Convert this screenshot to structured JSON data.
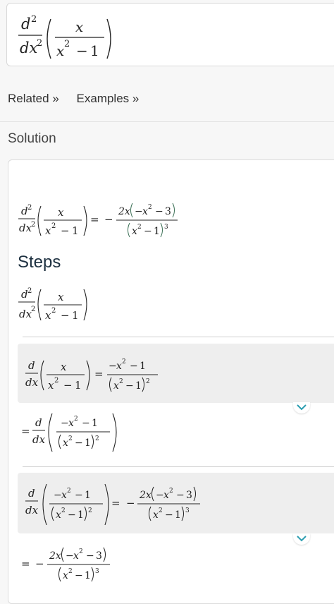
{
  "problem": {
    "d": "d",
    "two": "2",
    "dx": "dx",
    "x": "x",
    "minus": "−",
    "one": "1"
  },
  "tabs": {
    "related": "Related »",
    "examples": "Examples »"
  },
  "solution": {
    "title": "Solution"
  },
  "result": {
    "equals": "=",
    "neg": "−",
    "coef": "2x",
    "three": "3"
  },
  "steps": {
    "title": "Steps"
  },
  "colors": {
    "accent": "#3a6f55",
    "chevron": "#2a9db0"
  },
  "icons": {
    "expand": "chevron-down-icon"
  }
}
